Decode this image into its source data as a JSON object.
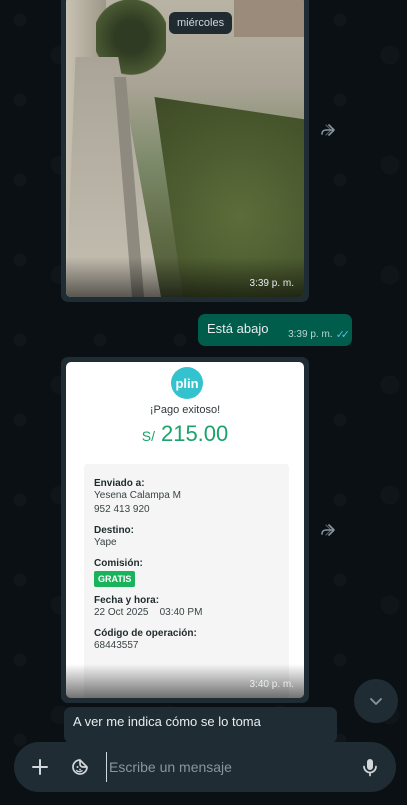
{
  "date_separator": "miércoles",
  "messages": [
    {
      "type": "image",
      "direction": "incoming",
      "time": "3:39 p. m."
    },
    {
      "type": "text",
      "direction": "outgoing",
      "text": "Está abajo",
      "time": "3:39 p. m.",
      "status": "read"
    },
    {
      "type": "image",
      "direction": "incoming",
      "time": "3:40 p. m.",
      "receipt": {
        "brand": "plin",
        "status": "¡Pago exitoso!",
        "currency": "S/",
        "amount": "215.00",
        "fields": [
          {
            "label": "Enviado a:",
            "value": "Yesena Calampa M",
            "value2": "952 413 920"
          },
          {
            "label": "Destino:",
            "value": "Yape"
          },
          {
            "label": "Comisión:",
            "badge": "GRATIS"
          },
          {
            "label": "Fecha y hora:",
            "value": "22 Oct 2025    03:40 PM"
          },
          {
            "label": "Código de operación:",
            "value": "68443557"
          }
        ]
      }
    },
    {
      "type": "text",
      "direction": "incoming",
      "text": "A ver me indica cómo se lo toma"
    }
  ],
  "composer": {
    "placeholder": "Escribe un mensaje"
  },
  "icons": {
    "forward": "forward-icon",
    "scroll": "chevron-down-icon",
    "attach": "plus-icon",
    "sticker": "sticker-icon",
    "mic": "mic-icon"
  },
  "colors": {
    "background": "#0b1014",
    "incoming_bubble": "#202c33",
    "outgoing_bubble": "#005c4b",
    "read_ticks": "#53bdeb",
    "amount_green": "#1aa36b",
    "badge_green": "#19b35c",
    "plin_blue": "#34c2cf"
  }
}
